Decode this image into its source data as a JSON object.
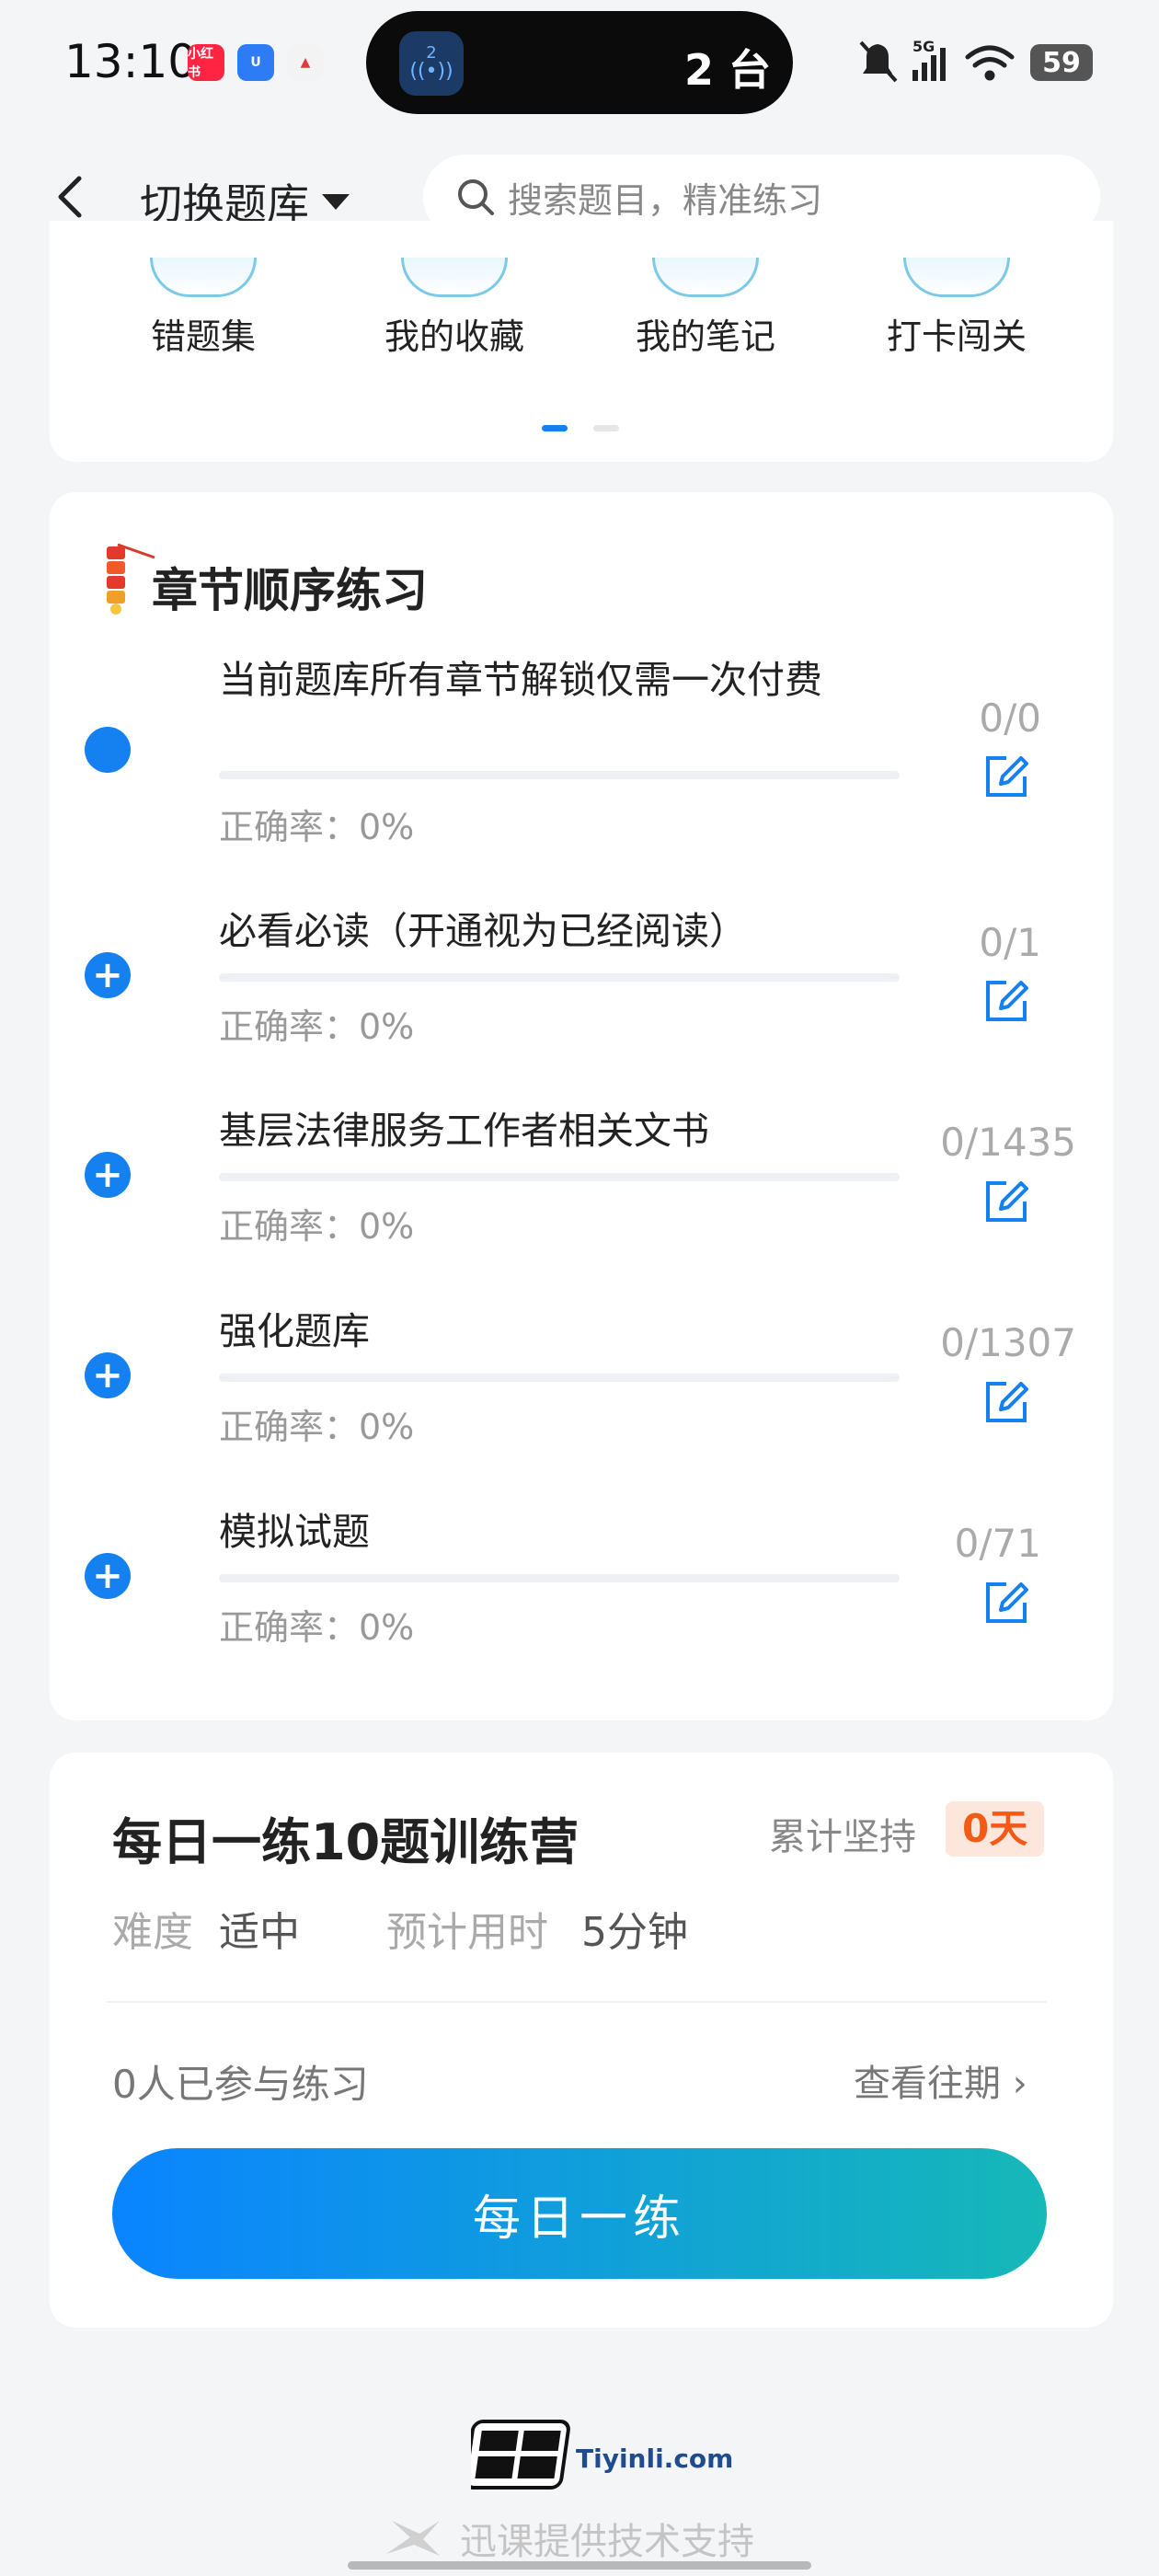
{
  "status_bar": {
    "time": "13:10",
    "app_badges": [
      "小红书",
      "U",
      "▲"
    ],
    "island_number": "2",
    "island_text": "2 台",
    "network": "5G",
    "battery": "59"
  },
  "header": {
    "switch_label": "切换题库",
    "search_placeholder": "搜索题目，精准练习"
  },
  "shortcuts": {
    "items": [
      {
        "label": "错题集",
        "icon": "wrong-questions-icon"
      },
      {
        "label": "我的收藏",
        "icon": "favorites-icon"
      },
      {
        "label": "我的笔记",
        "icon": "notes-icon"
      },
      {
        "label": "打卡闯关",
        "icon": "checkin-icon"
      }
    ],
    "page_count": 2,
    "active_page": 0
  },
  "chapter": {
    "title": "章节顺序练习",
    "rows": [
      {
        "title": "当前题库所有章节解锁仅需一次付费",
        "accuracy": "正确率：0%",
        "count": "0/0",
        "progress": 0
      },
      {
        "title": "必看必读（开通视为已经阅读）",
        "accuracy": "正确率：0%",
        "count": "0/1",
        "progress": 0
      },
      {
        "title": "基层法律服务工作者相关文书",
        "accuracy": "正确率：0%",
        "count": "0/1435",
        "progress": 0
      },
      {
        "title": "强化题库",
        "accuracy": "正确率：0%",
        "count": "0/1307",
        "progress": 0
      },
      {
        "title": "模拟试题",
        "accuracy": "正确率：0%",
        "count": "0/71",
        "progress": 0
      }
    ]
  },
  "daily": {
    "title": "每日一练10题训练营",
    "streak_label": "累计坚持",
    "streak_value": "0天",
    "difficulty_label": "难度",
    "difficulty_value": "适中",
    "time_label": "预计用时",
    "time_value": "5分钟",
    "participants": "0人已参与练习",
    "history_link": "查看往期 ›",
    "button": "每日一练"
  },
  "footer": {
    "logo_text": "Tiyinli.com",
    "support": "迅课提供技术支持"
  },
  "colors": {
    "accent": "#1580f0",
    "streak": "#f25a16",
    "button_start": "#0a84ff",
    "button_end": "#16b8b8"
  }
}
